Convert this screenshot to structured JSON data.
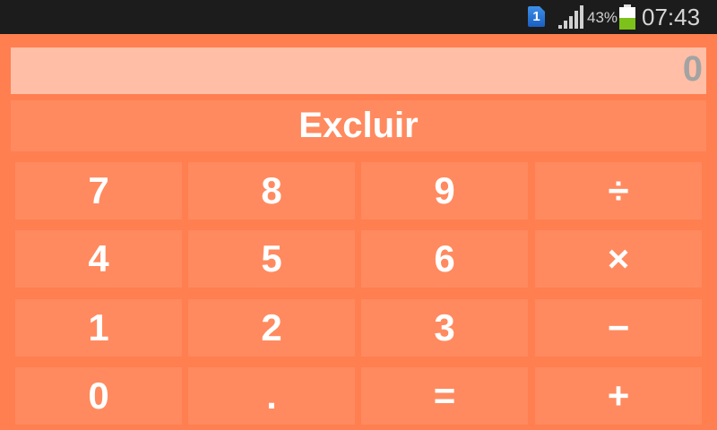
{
  "status_bar": {
    "notification_badge": "1",
    "battery_percent": "43%",
    "time": "07:43",
    "icons": [
      "notification-icon",
      "signal-icon",
      "battery-icon"
    ]
  },
  "display": {
    "value": "0"
  },
  "clear_button": {
    "label": "Excluir"
  },
  "keypad": {
    "rows": [
      [
        "7",
        "8",
        "9",
        "÷"
      ],
      [
        "4",
        "5",
        "6",
        "×"
      ],
      [
        "1",
        "2",
        "3",
        "−"
      ],
      [
        "0",
        ".",
        "=",
        "+"
      ]
    ]
  },
  "colors": {
    "background": "#ff7f50",
    "key": "#ff8a5f",
    "display": "#ffbea5",
    "display_text": "#a3a3a3",
    "status_bar": "#1c1c1c"
  }
}
